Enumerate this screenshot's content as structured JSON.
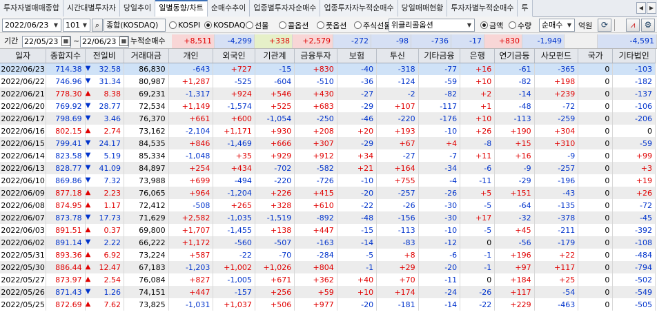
{
  "tabs": [
    "투자자별매매종합",
    "시간대별투자자",
    "당일추이",
    "일별동향/차트",
    "순매수추이",
    "업종별투자자순매수",
    "업종투자자누적순매수",
    "당일매매현황",
    "투자자별누적순매수",
    "투"
  ],
  "active_tab": 3,
  "toolbar": {
    "date": "2022/06/23",
    "code": "101",
    "market_name": "종합(KOSDAQ)",
    "radios_market": [
      {
        "label": "KOSPI",
        "on": false
      },
      {
        "label": "KOSDAQ",
        "on": true
      },
      {
        "label": "선물",
        "on": false
      },
      {
        "label": "콜옵션",
        "on": false
      },
      {
        "label": "풋옵션",
        "on": false
      },
      {
        "label": "주식선물",
        "on": false
      }
    ],
    "weekly_option": "위클리콜옵션",
    "radios_unit": [
      {
        "label": "금액",
        "on": true
      },
      {
        "label": "수량",
        "on": false
      }
    ],
    "mode": "순매수",
    "unit": "억원"
  },
  "period": {
    "label": "기간",
    "from": "22/05/23",
    "tilde": "~",
    "to": "22/06/23",
    "total_label": "누적순매수",
    "totals": [
      "+8,511",
      "-4,299",
      "+338",
      "+2,579",
      "-272",
      "-98",
      "-736",
      "-17",
      "+830",
      "-1,949",
      "",
      "-4,591"
    ]
  },
  "columns": [
    "일자",
    "종합지수",
    "전일비",
    "거래대금",
    "개인",
    "외국인",
    "기관계",
    "금융투자",
    "보험",
    "투신",
    "기타금융",
    "은행",
    "연기금등",
    "사모펀드",
    "국가",
    "기타법인"
  ],
  "rows": [
    {
      "date": "2022/06/23",
      "index": "714.38",
      "dir": "down",
      "chg": "32.58",
      "amount": "86,830",
      "v": [
        "-643",
        "+727",
        "-15",
        "+830",
        "-40",
        "-318",
        "-77",
        "+16",
        "-61",
        "-365",
        "0",
        "-103"
      ]
    },
    {
      "date": "2022/06/22",
      "index": "746.96",
      "dir": "down",
      "chg": "31.34",
      "amount": "80,987",
      "v": [
        "+1,287",
        "-525",
        "-604",
        "-510",
        "-36",
        "-124",
        "-59",
        "+10",
        "-82",
        "+198",
        "0",
        "-182"
      ]
    },
    {
      "date": "2022/06/21",
      "index": "778.30",
      "dir": "up",
      "chg": "8.38",
      "amount": "69,231",
      "v": [
        "-1,317",
        "+924",
        "+546",
        "+430",
        "-27",
        "-2",
        "-82",
        "+2",
        "-14",
        "+239",
        "0",
        "-137"
      ]
    },
    {
      "date": "2022/06/20",
      "index": "769.92",
      "dir": "down",
      "chg": "28.77",
      "amount": "72,534",
      "v": [
        "+1,149",
        "-1,574",
        "+525",
        "+683",
        "-29",
        "+107",
        "-117",
        "+1",
        "-48",
        "-72",
        "0",
        "-106"
      ]
    },
    {
      "date": "2022/06/17",
      "index": "798.69",
      "dir": "down",
      "chg": "3.46",
      "amount": "76,370",
      "v": [
        "+661",
        "+600",
        "-1,054",
        "-250",
        "-46",
        "-220",
        "-176",
        "+10",
        "-113",
        "-259",
        "0",
        "-206"
      ]
    },
    {
      "date": "2022/06/16",
      "index": "802.15",
      "dir": "up",
      "chg": "2.74",
      "amount": "73,162",
      "v": [
        "-2,104",
        "+1,171",
        "+930",
        "+208",
        "+20",
        "+193",
        "-10",
        "+26",
        "+190",
        "+304",
        "0",
        "0"
      ]
    },
    {
      "date": "2022/06/15",
      "index": "799.41",
      "dir": "down",
      "chg": "24.17",
      "amount": "84,535",
      "v": [
        "+846",
        "-1,469",
        "+666",
        "+307",
        "-29",
        "+67",
        "+4",
        "-8",
        "+15",
        "+310",
        "0",
        "-59"
      ]
    },
    {
      "date": "2022/06/14",
      "index": "823.58",
      "dir": "down",
      "chg": "5.19",
      "amount": "85,334",
      "v": [
        "-1,048",
        "+35",
        "+929",
        "+912",
        "+34",
        "-27",
        "-7",
        "+11",
        "+16",
        "-9",
        "0",
        "+99"
      ]
    },
    {
      "date": "2022/06/13",
      "index": "828.77",
      "dir": "down",
      "chg": "41.09",
      "amount": "84,897",
      "v": [
        "+254",
        "+434",
        "-702",
        "-582",
        "+21",
        "+164",
        "-34",
        "-6",
        "-9",
        "-257",
        "0",
        "+3"
      ]
    },
    {
      "date": "2022/06/10",
      "index": "869.86",
      "dir": "down",
      "chg": "7.32",
      "amount": "73,988",
      "v": [
        "+699",
        "-494",
        "-220",
        "-726",
        "-10",
        "+755",
        "-4",
        "-11",
        "-29",
        "-196",
        "0",
        "+19"
      ]
    },
    {
      "date": "2022/06/09",
      "index": "877.18",
      "dir": "up",
      "chg": "2.23",
      "amount": "76,065",
      "v": [
        "+964",
        "-1,204",
        "+226",
        "+415",
        "-20",
        "-257",
        "-26",
        "+5",
        "+151",
        "-43",
        "0",
        "+26"
      ]
    },
    {
      "date": "2022/06/08",
      "index": "874.95",
      "dir": "up",
      "chg": "1.17",
      "amount": "72,412",
      "v": [
        "-508",
        "+265",
        "+328",
        "+610",
        "-22",
        "-26",
        "-30",
        "-5",
        "-64",
        "-135",
        "0",
        "-72"
      ]
    },
    {
      "date": "2022/06/07",
      "index": "873.78",
      "dir": "down",
      "chg": "17.73",
      "amount": "71,629",
      "v": [
        "+2,582",
        "-1,035",
        "-1,519",
        "-892",
        "-48",
        "-156",
        "-30",
        "+17",
        "-32",
        "-378",
        "0",
        "-45"
      ]
    },
    {
      "date": "2022/06/03",
      "index": "891.51",
      "dir": "up",
      "chg": "0.37",
      "amount": "69,800",
      "v": [
        "+1,707",
        "-1,455",
        "+138",
        "+447",
        "-15",
        "-113",
        "-10",
        "-5",
        "+45",
        "-211",
        "0",
        "-392"
      ]
    },
    {
      "date": "2022/06/02",
      "index": "891.14",
      "dir": "down",
      "chg": "2.22",
      "amount": "66,222",
      "v": [
        "+1,172",
        "-560",
        "-507",
        "-163",
        "-14",
        "-83",
        "-12",
        "0",
        "-56",
        "-179",
        "0",
        "-108"
      ]
    },
    {
      "date": "2022/05/31",
      "index": "893.36",
      "dir": "up",
      "chg": "6.92",
      "amount": "73,224",
      "v": [
        "+587",
        "-22",
        "-70",
        "-284",
        "-5",
        "+8",
        "-6",
        "-1",
        "+196",
        "+22",
        "0",
        "-484"
      ]
    },
    {
      "date": "2022/05/30",
      "index": "886.44",
      "dir": "up",
      "chg": "12.47",
      "amount": "67,183",
      "v": [
        "-1,203",
        "+1,002",
        "+1,026",
        "+804",
        "-1",
        "+29",
        "-20",
        "-1",
        "+97",
        "+117",
        "0",
        "-794"
      ]
    },
    {
      "date": "2022/05/27",
      "index": "873.97",
      "dir": "up",
      "chg": "2.54",
      "amount": "76,084",
      "v": [
        "+827",
        "-1,005",
        "+671",
        "+362",
        "+40",
        "+70",
        "-11",
        "0",
        "+184",
        "+25",
        "0",
        "-502"
      ]
    },
    {
      "date": "2022/05/26",
      "index": "871.43",
      "dir": "down",
      "chg": "1.26",
      "amount": "74,151",
      "v": [
        "+447",
        "-157",
        "+256",
        "+59",
        "+10",
        "+174",
        "-24",
        "-26",
        "+117",
        "-54",
        "0",
        "-549"
      ]
    },
    {
      "date": "2022/05/25",
      "index": "872.69",
      "dir": "up",
      "chg": "7.62",
      "amount": "73,825",
      "v": [
        "-1,031",
        "+1,037",
        "+506",
        "+977",
        "-20",
        "-181",
        "-14",
        "-22",
        "+229",
        "-463",
        "0",
        "-505"
      ]
    }
  ],
  "colors": {
    "up": "#e00000",
    "down": "#0033cc",
    "selected": "#cfe2f7",
    "stripe": "#ececec",
    "accent": "#3b6fb6"
  },
  "icons": {
    "refresh": "refresh-icon",
    "chart": "chart-icon",
    "settings": "gear-icon",
    "calendar": "calendar-icon"
  }
}
